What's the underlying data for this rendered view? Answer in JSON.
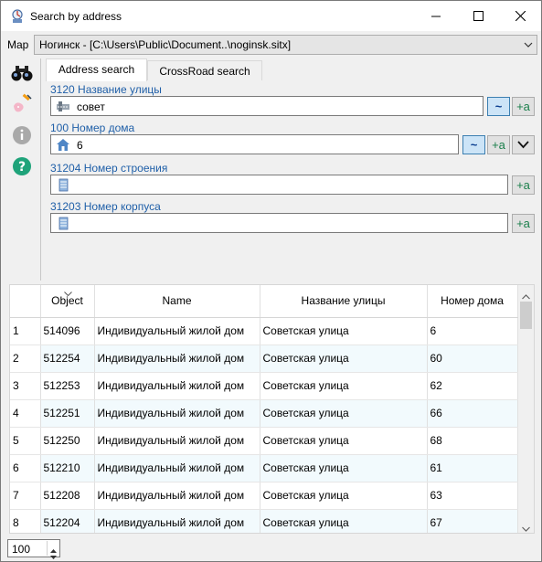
{
  "window": {
    "title": "Search by address"
  },
  "map": {
    "label": "Map",
    "value": "Ногинск - [C:\\Users\\Public\\Document..\\noginsk.sitx]"
  },
  "tabs": [
    {
      "label": "Address search"
    },
    {
      "label": "CrossRoad search"
    }
  ],
  "fields": [
    {
      "label": "3120 Название улицы",
      "value": "совет",
      "icon": "street-icon"
    },
    {
      "label": "100 Номер дома",
      "value": "6",
      "icon": "house-icon"
    },
    {
      "label": "31204 Номер строения",
      "value": "",
      "icon": "building-icon"
    },
    {
      "label": "31203 Номер корпуса",
      "value": "",
      "icon": "building-icon"
    }
  ],
  "buttons": {
    "tilde": "~",
    "add": "+a"
  },
  "grid": {
    "columns": [
      "Object",
      "Name",
      "Название улицы",
      "Номер дома"
    ],
    "rows": [
      {
        "n": "1",
        "object": "514096",
        "name": "Индивидуальный жилой дом",
        "street": "Советская улица",
        "house": "6"
      },
      {
        "n": "2",
        "object": "512254",
        "name": "Индивидуальный жилой дом",
        "street": "Советская улица",
        "house": "60"
      },
      {
        "n": "3",
        "object": "512253",
        "name": "Индивидуальный жилой дом",
        "street": "Советская улица",
        "house": "62"
      },
      {
        "n": "4",
        "object": "512251",
        "name": "Индивидуальный жилой дом",
        "street": "Советская улица",
        "house": "66"
      },
      {
        "n": "5",
        "object": "512250",
        "name": "Индивидуальный жилой дом",
        "street": "Советская улица",
        "house": "68"
      },
      {
        "n": "6",
        "object": "512210",
        "name": "Индивидуальный жилой дом",
        "street": "Советская улица",
        "house": "61"
      },
      {
        "n": "7",
        "object": "512208",
        "name": "Индивидуальный жилой дом",
        "street": "Советская улица",
        "house": "63"
      },
      {
        "n": "8",
        "object": "512204",
        "name": "Индивидуальный жилой дом",
        "street": "Советская улица",
        "house": "67"
      }
    ]
  },
  "limit": {
    "value": "100"
  },
  "colors": {
    "accent": "#1f5fa8",
    "alt_row": "#f2fafd",
    "toggle_on": "#cce4f7"
  }
}
